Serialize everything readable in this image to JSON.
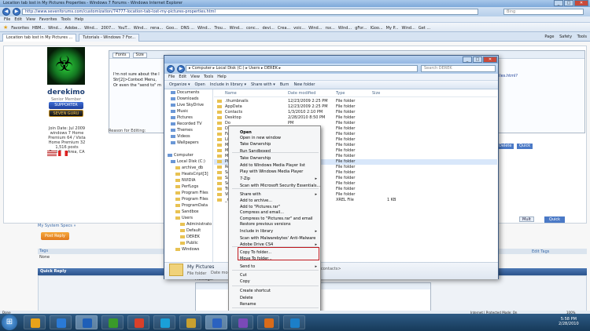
{
  "browser": {
    "title": "Location tab lost in My Pictures Properties - Windows 7 Forums - Windows Internet Explorer",
    "url": "http://www.sevenforums.com/customization/74777-location-tab-lost-my-pictures-properties.html",
    "search_placeholder": "Bing",
    "menu": [
      "File",
      "Edit",
      "View",
      "Favorites",
      "Tools",
      "Help"
    ],
    "favorites_label": "Favorites",
    "favorites": [
      "HBM...",
      "Wind...",
      "Adobe...",
      "Wind...",
      "2007...",
      "YouT...",
      "Wind...",
      "rena...",
      "Goo...",
      "DNS ...",
      "Wind...",
      "Trou...",
      "Wind...",
      "conc...",
      "devi...",
      "Crea...",
      "voic...",
      "Wind...",
      "rsx...",
      "Wind...",
      "gFor...",
      "IGoo...",
      "My P...",
      "Wind...",
      "Get ..."
    ],
    "tabs": [
      "Location tab lost in My Pictures ...",
      "Tutorials - Windows 7 For..."
    ],
    "toolbar": [
      "Page",
      "Safety",
      "Tools"
    ],
    "status_left": "Done",
    "status_zone": "Internet | Protected Mode: On",
    "zoom": "100%"
  },
  "forum": {
    "username": "derekimo",
    "rank": "Senior Member",
    "badge1": "SUPPORTER",
    "badge2": "SEVEN GURU",
    "userinfo": [
      "Join Date: Jul 2009",
      "windows 7 Home",
      "Premium 64 / Vista",
      "Home Premium 32",
      "1,516 posts",
      "East Bay Area, CA"
    ],
    "editor_font": "Fonts",
    "editor_size": "Size",
    "post_text": [
      "I'm not sure about the l",
      "Str[2]>Context Menu,",
      "Or even the \"send to\" m"
    ],
    "url_text": "tiles.html?",
    "reason_label": "Reason for Editing:",
    "delete_btn": "Delete",
    "quick_btn": "Quick",
    "go_advanced": "Mult",
    "quick_btn2": "Quick",
    "system_books": "My System Specs »",
    "post_reply": "Post Reply",
    "tags_label": "Tags",
    "tags_value": "None",
    "edit_tags": "Edit Tags",
    "quick_reply": "Quick Reply",
    "message_label": "Message:"
  },
  "explorer": {
    "address": "▸ Computer ▸ Local Disk (C:) ▸ Users ▸ DEREK ▸",
    "search": "Search DEREK",
    "menu": [
      "File",
      "Edit",
      "View",
      "Tools",
      "Help"
    ],
    "commands": [
      "Organize ▾",
      "Open",
      "Include in library ▾",
      "Share with ▾",
      "Burn",
      "New folder"
    ],
    "nav": [
      "Documents",
      "Downloads",
      "Live SkyDrive",
      "Music",
      "Pictures",
      "Recorded TV",
      "Themes",
      "Videos",
      "Wallpapers",
      "",
      "Computer",
      "Local Disk (C:)",
      "archive_db",
      "HeatsCript[3]",
      "NVIDIA",
      "PerfLogs",
      "Program Files",
      "Program Files",
      "ProgramData",
      "Sandbox",
      "Users",
      "Administrato",
      "Default",
      "DEREK",
      "Public",
      "Windows"
    ],
    "columns": [
      "Name",
      "Date modified",
      "Type",
      "Size"
    ],
    "files": [
      {
        "name": ".thumbnails",
        "date": "12/23/2009 2:25 PM",
        "type": "File folder",
        "size": ""
      },
      {
        "name": "AppData",
        "date": "12/23/2009 2:25 PM",
        "type": "File folder",
        "size": ""
      },
      {
        "name": "Contacts",
        "date": "1/3/2010 2:10 PM",
        "type": "File folder",
        "size": ""
      },
      {
        "name": "Desktop",
        "date": "2/28/2010 8:50 PM",
        "type": "File folder",
        "size": ""
      },
      {
        "name": "Do",
        "date": "PM",
        "type": "File folder",
        "size": ""
      },
      {
        "name": "Do",
        "date": "PM",
        "type": "File folder",
        "size": ""
      },
      {
        "name": "Fa",
        "date": "PM",
        "type": "File folder",
        "size": ""
      },
      {
        "name": "Li",
        "date": "PM",
        "type": "File folder",
        "size": ""
      },
      {
        "name": "M",
        "date": "PM",
        "type": "File folder",
        "size": ""
      },
      {
        "name": "M",
        "date": "PM",
        "type": "File folder",
        "size": ""
      },
      {
        "name": "M",
        "date": "PM",
        "type": "File folder",
        "size": ""
      },
      {
        "name": "Pi",
        "date": "PM",
        "type": "File folder",
        "size": ""
      },
      {
        "name": "Re",
        "date": "PM",
        "type": "File folder",
        "size": ""
      },
      {
        "name": "Sa",
        "date": "PM",
        "type": "File folder",
        "size": ""
      },
      {
        "name": "Sa",
        "date": "PM",
        "type": "File folder",
        "size": ""
      },
      {
        "name": "Se",
        "date": "PM",
        "type": "File folder",
        "size": ""
      },
      {
        "name": "Tr",
        "date": "PM",
        "type": "File folder",
        "size": ""
      },
      {
        "name": "Vi",
        "date": "PM",
        "type": "File folder",
        "size": ""
      },
      {
        "name": "_r",
        "date": "PM",
        "type": "XREL File",
        "size": "1 KB"
      }
    ],
    "status_name": "My Pictures",
    "status_type": "File folder",
    "status_modified": "Date modi",
    "status_contact": "contacts>"
  },
  "context_menu": [
    {
      "label": "Open",
      "bold": true
    },
    {
      "label": "Open in new window"
    },
    {
      "label": "Take Ownership"
    },
    {
      "label": "Run Sandboxed"
    },
    {
      "label": "Take Ownership"
    },
    {
      "label": "Add to Windows Media Player list"
    },
    {
      "label": "Play with Windows Media Player"
    },
    {
      "label": "7-Zip",
      "sub": true
    },
    {
      "label": "Scan with Microsoft Security Essentials..."
    },
    {
      "label": "Share with",
      "sub": true
    },
    {
      "label": "Add to archive..."
    },
    {
      "label": "Add to \"Pictures.rar\""
    },
    {
      "label": "Compress and email..."
    },
    {
      "label": "Compress to \"Pictures.rar\" and email"
    },
    {
      "label": "Restore previous versions"
    },
    {
      "label": "Include in library",
      "sub": true
    },
    {
      "label": "Scan with Malwarebytes' Anti-Malware"
    },
    {
      "label": "Adobe Drive CS4",
      "sub": true
    },
    {
      "label": "Copy To folder..."
    },
    {
      "label": "Move To folder..."
    },
    {
      "label": "Send to",
      "sub": true
    },
    {
      "label": "Cut"
    },
    {
      "label": "Copy"
    },
    {
      "label": "Create shortcut"
    },
    {
      "label": "Delete"
    },
    {
      "label": "Rename"
    },
    {
      "label": "Properties"
    }
  ],
  "taskbar": {
    "time": "5:58 PM",
    "date": "2/28/2010"
  },
  "colors": {
    "accent": "#3b6aa8",
    "highlight_box": "#c0181d",
    "taskbar": "#173a5a"
  }
}
